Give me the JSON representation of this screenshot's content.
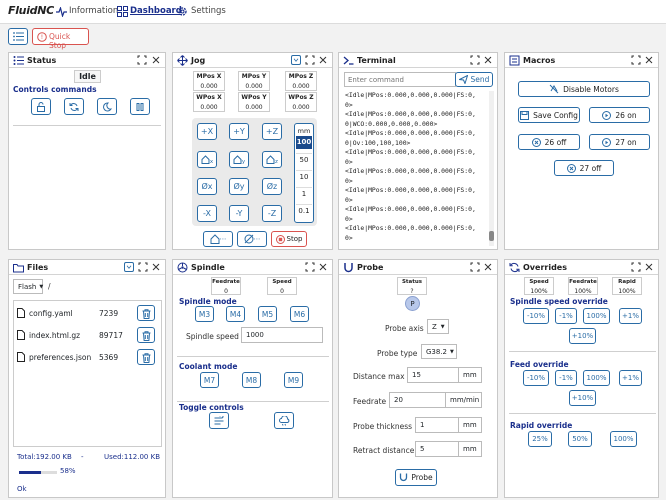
{
  "nav": {
    "logo": "Fluid",
    "logo_nc": "NC",
    "information": "Information",
    "dashboard": "Dashboard",
    "settings": "Settings"
  },
  "toolbar": {
    "quick_stop": "Quick Stop"
  },
  "status": {
    "title": "Status",
    "state": "Idle",
    "controls_label": "Controls commands"
  },
  "jog": {
    "title": "Jog",
    "mpos_x_label": "MPos X",
    "mpos_y_label": "MPos Y",
    "mpos_z_label": "MPos Z",
    "mpos_x": "0.000",
    "mpos_y": "0.000",
    "mpos_z": "0.000",
    "wpos_x_label": "WPos X",
    "wpos_y_label": "WPos Y",
    "wpos_z_label": "WPos Z",
    "wpos_x": "0.000",
    "wpos_y": "0.000",
    "wpos_z": "0.000",
    "plus_x": "+X",
    "plus_y": "+Y",
    "plus_z": "+Z",
    "home_x_sub": "x",
    "home_y_sub": "y",
    "home_z_sub": "z",
    "zero_x": "Øx",
    "zero_y": "Øy",
    "zero_z": "Øz",
    "minus_x": "-X",
    "minus_y": "-Y",
    "minus_z": "-Z",
    "unit": "mm",
    "steps": [
      "100",
      "50",
      "10",
      "1",
      "0.1"
    ],
    "selected_step": "100",
    "home_all": "⋯",
    "zero_all": "⋯",
    "stop": "Stop"
  },
  "terminal": {
    "title": "Terminal",
    "placeholder": "Enter command",
    "send": "Send",
    "lines": [
      "<Idle|MPos:0.000,0.000,0.000|FS:0,",
      "0>",
      "<Idle|MPos:0.000,0.000,0.000|FS:0,",
      "0|WCO:0.000,0.000,0.000>",
      "<Idle|MPos:0.000,0.000,0.000|FS:0,",
      "0|Ov:100,100,100>",
      "<Idle|MPos:0.000,0.000,0.000|FS:0,",
      "0>",
      "<Idle|MPos:0.000,0.000,0.000|FS:0,",
      "0>",
      "<Idle|MPos:0.000,0.000,0.000|FS:0,",
      "0>",
      "<Idle|MPos:0.000,0.000,0.000|FS:0,",
      "0>",
      "<Idle|MPos:0.000,0.000,0.000|FS:0,",
      "0>"
    ]
  },
  "macros": {
    "title": "Macros",
    "disable_motors": "Disable Motors",
    "save_config": "Save Config",
    "on26": "26 on",
    "off26": "26 off",
    "on27": "27 on",
    "off27": "27 off"
  },
  "files": {
    "title": "Files",
    "source": "Flash",
    "path": "/",
    "items": [
      {
        "name": "config.yaml",
        "size": "7239"
      },
      {
        "name": "index.html.gz",
        "size": "89717"
      },
      {
        "name": "preferences.json",
        "size": "5369"
      }
    ],
    "total": "Total:192.00 KB",
    "dash": "-",
    "used": "Used:112.00 KB",
    "percent": "58%",
    "percent_value": 58,
    "status": "Ok"
  },
  "spindle": {
    "title": "Spindle",
    "feedrate_label": "Feedrate",
    "feedrate": "0",
    "speed_label": "Speed",
    "speed": "0",
    "mode_label": "Spindle mode",
    "m3": "M3",
    "m4": "M4",
    "m5": "M5",
    "m6": "M6",
    "speed_field_label": "Spindle speed",
    "speed_value": "1000",
    "coolant_label": "Coolant mode",
    "m7": "M7",
    "m8": "M8",
    "m9": "M9",
    "toggle_label": "Toggle controls"
  },
  "probe": {
    "title": "Probe",
    "status_label": "Status",
    "status_value": "?",
    "probe_letter": "P",
    "axis_label": "Probe axis",
    "axis_value": "Z",
    "type_label": "Probe type",
    "type_value": "G38.2",
    "dist_label": "Distance max",
    "dist_value": "15",
    "dist_unit": "mm",
    "feed_label": "Feedrate",
    "feed_value": "20",
    "feed_unit": "mm/min",
    "thick_label": "Probe thickness",
    "thick_value": "1",
    "thick_unit": "mm",
    "retract_label": "Retract distance",
    "retract_value": "5",
    "retract_unit": "mm",
    "probe_button": "Probe"
  },
  "overrides": {
    "title": "Overrides",
    "speed_label": "Speed",
    "speed_value": "100%",
    "feed_label": "Feedrate",
    "feed_value": "100%",
    "rapid_label": "Rapid",
    "rapid_value": "100%",
    "spindle_section": "Spindle speed override",
    "feed_section": "Feed override",
    "rapid_section": "Rapid override",
    "m10": "-10%",
    "m1": "-1%",
    "p100": "100%",
    "p1": "+1%",
    "p10": "+10%",
    "r25": "25%",
    "r50": "50%",
    "r100": "100%"
  }
}
